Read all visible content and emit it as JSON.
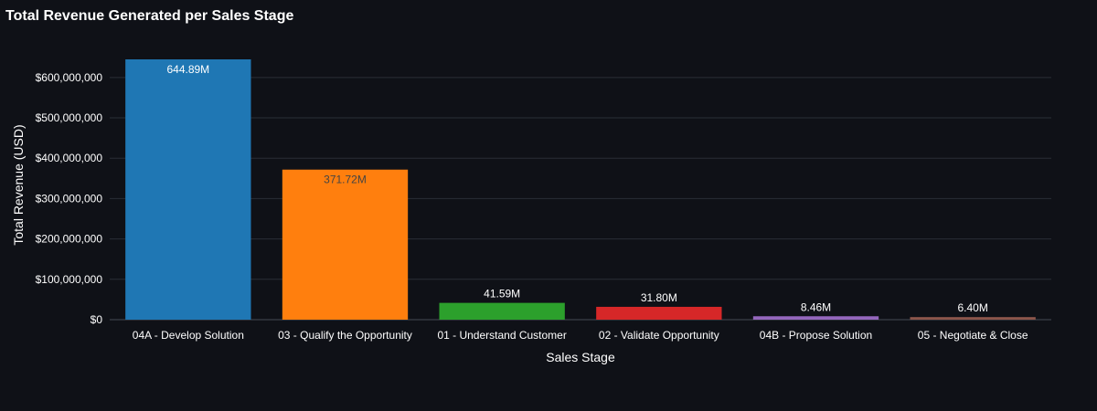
{
  "chart_data": {
    "type": "bar",
    "title": "Total Revenue Generated per Sales Stage",
    "xlabel": "Sales Stage",
    "ylabel": "Total Revenue (USD)",
    "categories": [
      "04A - Develop Solution",
      "03 - Qualify the Opportunity",
      "01 - Understand Customer",
      "02 - Validate Opportunity",
      "04B - Propose Solution",
      "05 - Negotiate & Close"
    ],
    "values": [
      644890000,
      371720000,
      41590000,
      31800000,
      8460000,
      6400000
    ],
    "data_labels": [
      "644.89M",
      "371.72M",
      "41.59M",
      "31.80M",
      "8.46M",
      "6.40M"
    ],
    "label_inside": [
      true,
      true,
      false,
      false,
      false,
      false
    ],
    "colors": [
      "#1f77b4",
      "#ff7f0e",
      "#2ca02c",
      "#d62728",
      "#9467bd",
      "#8c564b"
    ],
    "label_colors": [
      "#ffffff",
      "#444444",
      "#ffffff",
      "#ffffff",
      "#ffffff",
      "#ffffff"
    ],
    "yticks": [
      0,
      100000000,
      200000000,
      300000000,
      400000000,
      500000000,
      600000000
    ],
    "ytick_labels": [
      "$0",
      "$100,000,000",
      "$200,000,000",
      "$300,000,000",
      "$400,000,000",
      "$500,000,000",
      "$600,000,000"
    ],
    "ylim": [
      0,
      644890000
    ],
    "grid": true,
    "gridColor": "#2a2e37"
  }
}
